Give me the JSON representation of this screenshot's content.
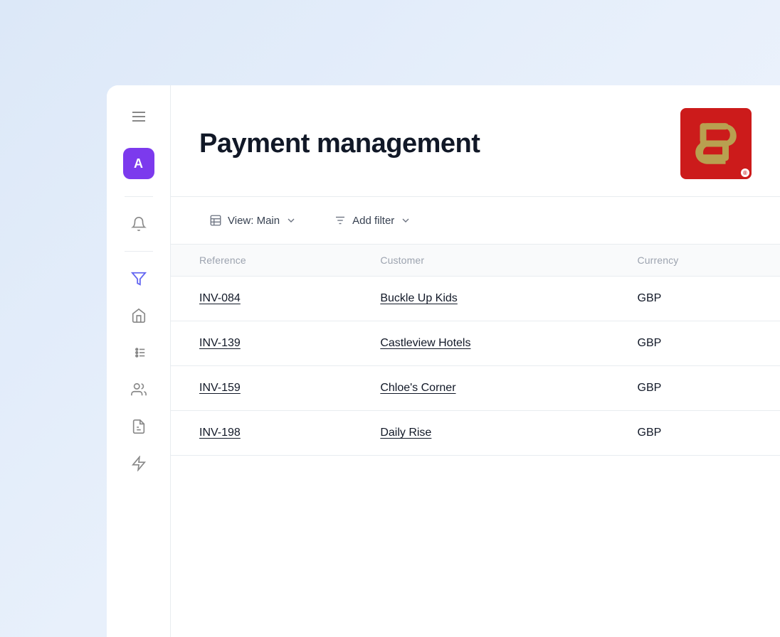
{
  "page": {
    "title": "Payment management",
    "background": "#dce8f8"
  },
  "sidebar": {
    "avatar_label": "A",
    "items": [
      {
        "name": "home",
        "label": "Home",
        "active": false
      },
      {
        "name": "tasks",
        "label": "Tasks",
        "active": false
      },
      {
        "name": "filter",
        "label": "Filter / Active",
        "active": true
      },
      {
        "name": "contacts",
        "label": "Contacts",
        "active": false
      },
      {
        "name": "documents",
        "label": "Documents",
        "active": false
      },
      {
        "name": "lightning",
        "label": "Automation",
        "active": false
      }
    ]
  },
  "toolbar": {
    "view_label": "View: Main",
    "filter_label": "Add filter"
  },
  "table": {
    "columns": [
      {
        "key": "reference",
        "label": "Reference"
      },
      {
        "key": "customer",
        "label": "Customer"
      },
      {
        "key": "currency",
        "label": "Currency"
      }
    ],
    "rows": [
      {
        "reference": "INV-084",
        "customer": "Buckle Up Kids",
        "currency": "GBP"
      },
      {
        "reference": "INV-139",
        "customer": "Castleview Hotels",
        "currency": "GBP"
      },
      {
        "reference": "INV-159",
        "customer": "Chloe's Corner",
        "currency": "GBP"
      },
      {
        "reference": "INV-198",
        "customer": "Daily Rise",
        "currency": "GBP"
      }
    ]
  },
  "brand": {
    "registered_symbol": "®"
  }
}
